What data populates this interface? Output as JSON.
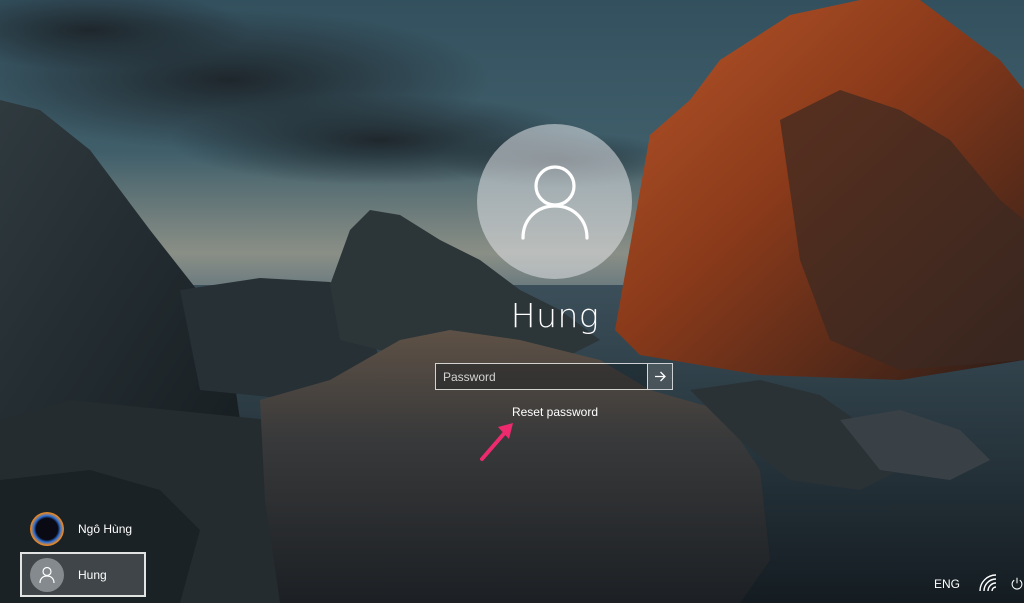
{
  "login": {
    "user_name": "Hung",
    "password_placeholder": "Password",
    "password_value": "",
    "reset_label": "Reset password"
  },
  "users": [
    {
      "name": "Ngô Hùng",
      "avatar": "photo-avatar",
      "selected": false
    },
    {
      "name": "Hung",
      "avatar": "person-icon",
      "selected": true
    }
  ],
  "tray": {
    "language": "ENG",
    "icons": [
      "wifi-icon",
      "power-icon"
    ]
  },
  "colors": {
    "annotation_arrow": "#ee2a6e"
  }
}
